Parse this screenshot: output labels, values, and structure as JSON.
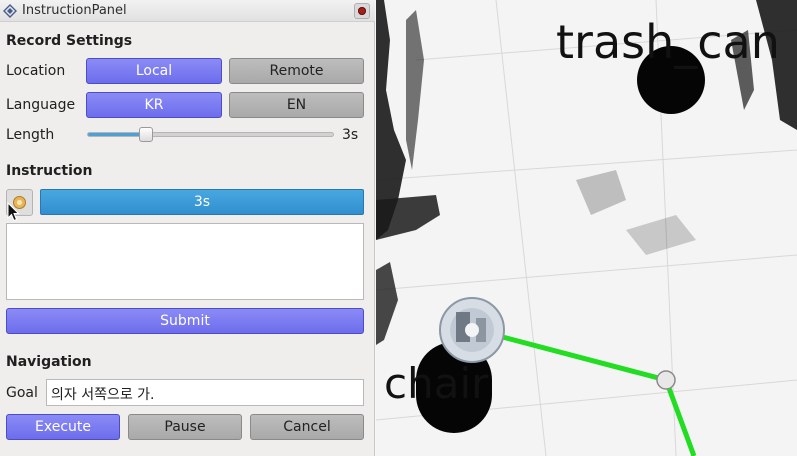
{
  "window": {
    "title": "InstructionPanel"
  },
  "record_settings": {
    "heading": "Record Settings",
    "location": {
      "label": "Location",
      "options": [
        "Local",
        "Remote"
      ],
      "selected": "Local"
    },
    "language": {
      "label": "Language",
      "options": [
        "KR",
        "EN"
      ],
      "selected": "KR"
    },
    "length": {
      "label": "Length",
      "value_text": "3s",
      "slider_fraction": 0.24
    }
  },
  "instruction": {
    "heading": "Instruction",
    "progress_text": "3s",
    "text": "",
    "submit_label": "Submit"
  },
  "navigation": {
    "heading": "Navigation",
    "goal_label": "Goal",
    "goal_value": "의자 서쪽으로 가.",
    "buttons": [
      "Execute",
      "Pause",
      "Cancel"
    ]
  },
  "viz": {
    "labels": [
      "trash_can",
      "chair"
    ],
    "path_color": "#22dd22"
  },
  "colors": {
    "active_button": "#7a7af2",
    "inactive_button": "#b3b3b3",
    "progress": "#3d9bd6"
  }
}
